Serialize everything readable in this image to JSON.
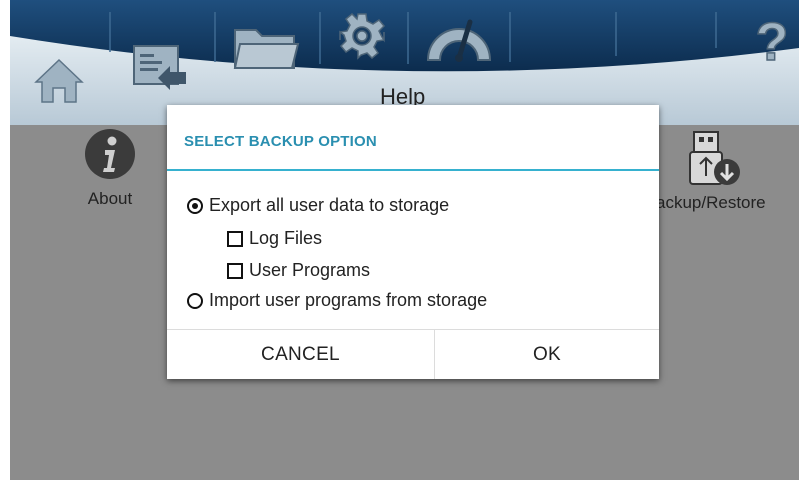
{
  "toolbar": {
    "icons": [
      "home-icon",
      "import-icon",
      "folder-icon",
      "gear-icon",
      "gauge-icon",
      "help-icon"
    ],
    "help_glyph": "?",
    "colors": {
      "bar_dark": "#123a63",
      "bar_light": "#cfdce6",
      "icon": "#9fb3c2"
    }
  },
  "page": {
    "title": "Help"
  },
  "tiles": {
    "about": {
      "label": "About",
      "icon": "info-icon"
    },
    "backup": {
      "label": "ackup/Restore",
      "icon": "usb-download-icon"
    }
  },
  "dialog": {
    "title": "SELECT BACKUP OPTION",
    "export_label": "Export all user data to storage",
    "export_selected": true,
    "log_files_label": "Log Files",
    "log_files_checked": false,
    "user_programs_label": "User Programs",
    "user_programs_checked": false,
    "import_label": "Import user programs from storage",
    "import_selected": false,
    "cancel_label": "CANCEL",
    "ok_label": "OK",
    "accent_color": "#36b1cf"
  }
}
